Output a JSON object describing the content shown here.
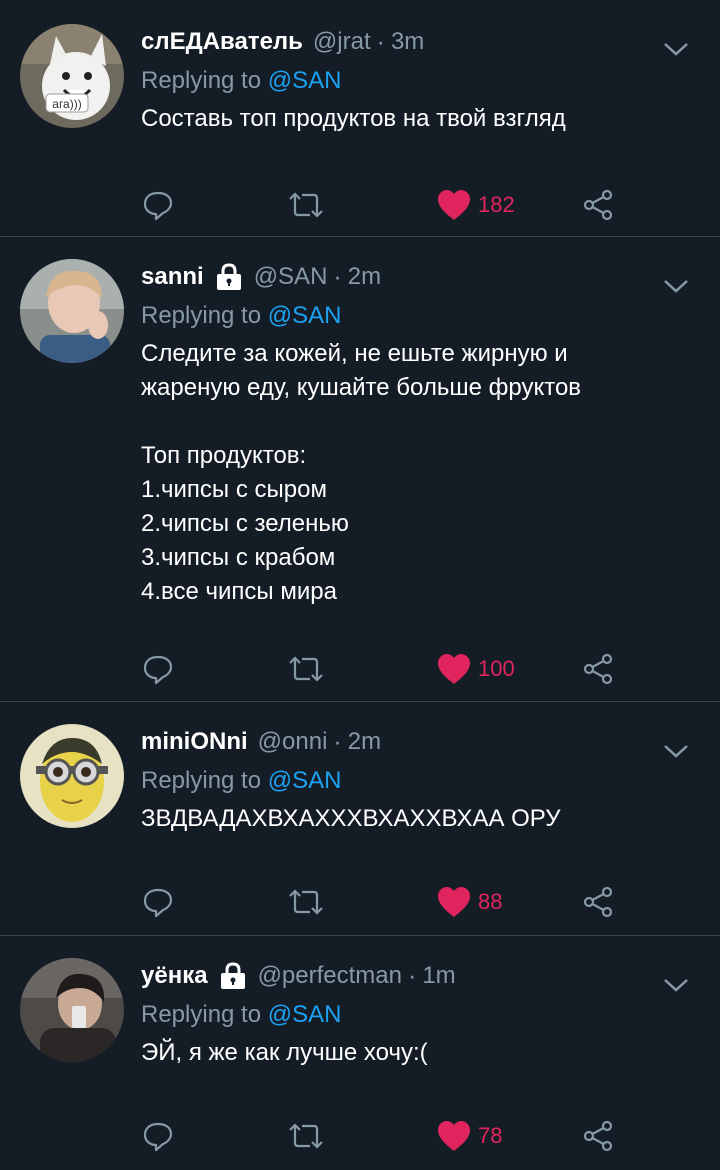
{
  "tweets": [
    {
      "name": "слЕДАватель",
      "handle": "@jrat",
      "time": "3m",
      "verified_lock": false,
      "reply_prefix": "Replying to ",
      "reply_to": "@SAN",
      "text": "Составь топ продуктов на твой взгляд",
      "likes": "182",
      "avatar_caption": "ага)))"
    },
    {
      "name": "sanni",
      "handle": "@SAN",
      "time": "2m",
      "verified_lock": true,
      "reply_prefix": "Replying to ",
      "reply_to": "@SAN",
      "text": "Следите за кожей, не ешьте жирную и\nжареную еду, кушайте больше фруктов\n\nТоп продуктов:\n1.чипсы с сыром\n2.чипсы с зеленью\n3.чипсы с крабом\n4.все чипсы мира",
      "likes": "100"
    },
    {
      "name": "miniONni",
      "handle": "@onni",
      "time": "2m",
      "verified_lock": false,
      "reply_prefix": "Replying to ",
      "reply_to": "@SAN",
      "text": "ЗВДВАДАХВХАХХХВХАХХВХАА ОРУ",
      "likes": "88"
    },
    {
      "name": "уёнка",
      "handle": "@perfectman",
      "time": "1m",
      "verified_lock": true,
      "reply_prefix": "Replying to ",
      "reply_to": "@SAN",
      "text": "ЭЙ, я же как лучше хочу:(",
      "likes": "78"
    }
  ],
  "separator": "·",
  "colors": {
    "background": "#141d26",
    "divider": "#38444d",
    "secondary_text": "#8899a6",
    "mention": "#1da1f2",
    "like": "#e0245e"
  },
  "icons": {
    "reply": "speech-bubble-icon",
    "retweet": "retweet-icon",
    "like": "heart-icon",
    "share": "share-icon",
    "menu": "chevron-down-icon",
    "lock": "lock-icon"
  }
}
